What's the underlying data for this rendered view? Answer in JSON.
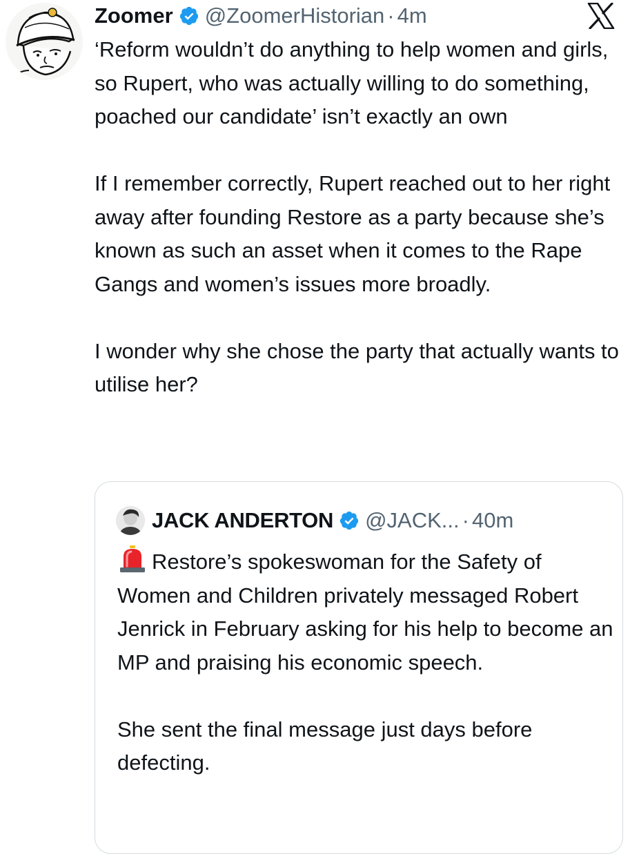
{
  "tweet": {
    "display_name": "Zoomer",
    "handle": "@ZoomerHistorian",
    "separator": "·",
    "time": "4m",
    "avatar_icon": "wojak-pith-helmet-avatar",
    "verified_icon": "verified-badge-icon",
    "platform_icon": "x-logo-icon",
    "paragraphs": [
      "‘Reform wouldn’t do anything to help women and girls, so Rupert, who was actually willing to do something, poached our candidate’ isn’t exactly an own",
      "If I remember correctly, Rupert reached out to her right away after founding Restore as a party because she’s known as such an asset when it comes to the Rape Gangs and women’s issues more broadly.",
      "I wonder why she chose the party that actually wants to utilise her?"
    ]
  },
  "quoted_tweet": {
    "display_name": "JACK ANDERTON",
    "handle": "@JACK...",
    "separator": "·",
    "time": "40m",
    "avatar_icon": "profile-photo-avatar",
    "verified_icon": "verified-badge-icon",
    "lead_icon": "siren-emoji-icon",
    "paragraphs": [
      "Restore’s spokeswoman for the Safety of Women and Children privately messaged Robert Jenrick in February asking for his help to become an MP and praising his economic speech.",
      "She sent the final message just days before defecting."
    ]
  },
  "colors": {
    "text": "#0f1419",
    "secondary_text": "#536471",
    "verified_blue": "#1d9bf0",
    "border": "#d6dce0"
  }
}
